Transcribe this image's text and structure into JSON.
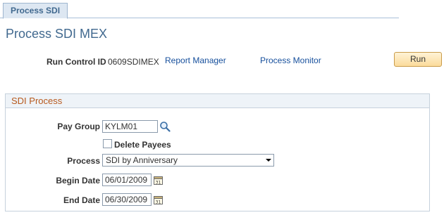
{
  "tab": {
    "label": "Process SDI"
  },
  "page": {
    "title": "Process SDI MEX"
  },
  "run_control": {
    "label": "Run Control ID",
    "value": "0609SDIMEX",
    "report_manager_link": "Report Manager",
    "process_monitor_link": "Process Monitor",
    "run_button": "Run"
  },
  "group": {
    "title": "SDI Process",
    "pay_group": {
      "label": "Pay Group",
      "value": "KYLM01"
    },
    "delete_payees": {
      "label": "Delete Payees",
      "checked": false
    },
    "process": {
      "label": "Process",
      "selected": "SDI by Anniversary"
    },
    "begin_date": {
      "label": "Begin Date",
      "value": "06/01/2009"
    },
    "end_date": {
      "label": "End Date",
      "value": "06/30/2009"
    }
  },
  "colors": {
    "title": "#41698f",
    "link": "#164f9c",
    "group_title": "#b7591d",
    "run_button": "#fbdb9b"
  },
  "icons": {
    "lookup": "magnifier-icon",
    "calendar": "calendar-icon",
    "dropdown": "chevron-down-icon"
  }
}
